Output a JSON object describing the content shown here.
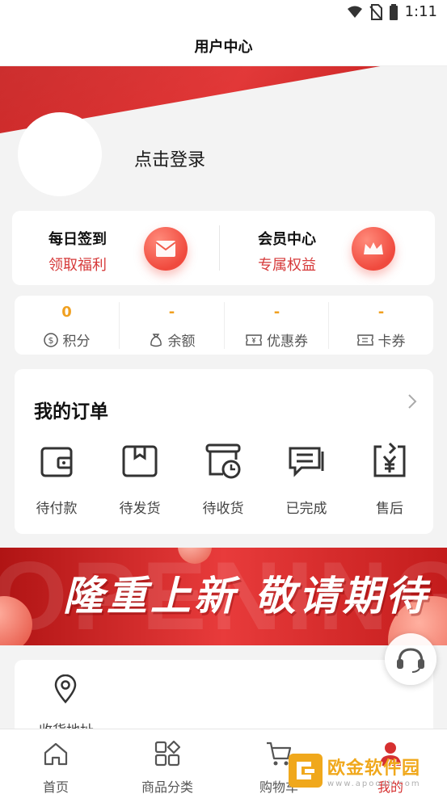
{
  "status_bar": {
    "time": "1:11",
    "icons": [
      "wifi-icon",
      "no-sim-icon",
      "battery-icon"
    ]
  },
  "header": {
    "title": "用户中心"
  },
  "profile": {
    "login_text": "点击登录"
  },
  "quick_actions": [
    {
      "title": "每日签到",
      "subtitle": "领取福利",
      "icon": "mail-icon"
    },
    {
      "title": "会员中心",
      "subtitle": "专属权益",
      "icon": "crown-icon"
    }
  ],
  "stats": [
    {
      "value": "0",
      "label": "积分",
      "icon": "dollar-icon"
    },
    {
      "value": "-",
      "label": "余额",
      "icon": "money-bag-icon"
    },
    {
      "value": "-",
      "label": "优惠券",
      "icon": "coupon-icon"
    },
    {
      "value": "-",
      "label": "卡券",
      "icon": "card-ticket-icon"
    }
  ],
  "orders": {
    "title": "我的订单",
    "items": [
      {
        "label": "待付款",
        "icon": "wallet-icon"
      },
      {
        "label": "待发货",
        "icon": "package-icon"
      },
      {
        "label": "待收货",
        "icon": "delivery-clock-icon"
      },
      {
        "label": "已完成",
        "icon": "chat-list-icon"
      },
      {
        "label": "售后",
        "icon": "yuan-refund-icon"
      }
    ]
  },
  "banner": {
    "headline": "隆重上新 敬请期待",
    "ghost_text": "OPENING"
  },
  "address": {
    "label": "收货地址"
  },
  "tabbar": [
    {
      "label": "首页",
      "icon": "home-icon"
    },
    {
      "label": "商品分类",
      "icon": "category-icon"
    },
    {
      "label": "购物车",
      "icon": "cart-icon"
    },
    {
      "label": "我的",
      "icon": "user-icon"
    }
  ],
  "watermark": {
    "main": "欧金软件园",
    "sub": "www.apoosh.com"
  },
  "colors": {
    "brand_red": "#d62b2b",
    "accent_orange": "#f0a020"
  }
}
